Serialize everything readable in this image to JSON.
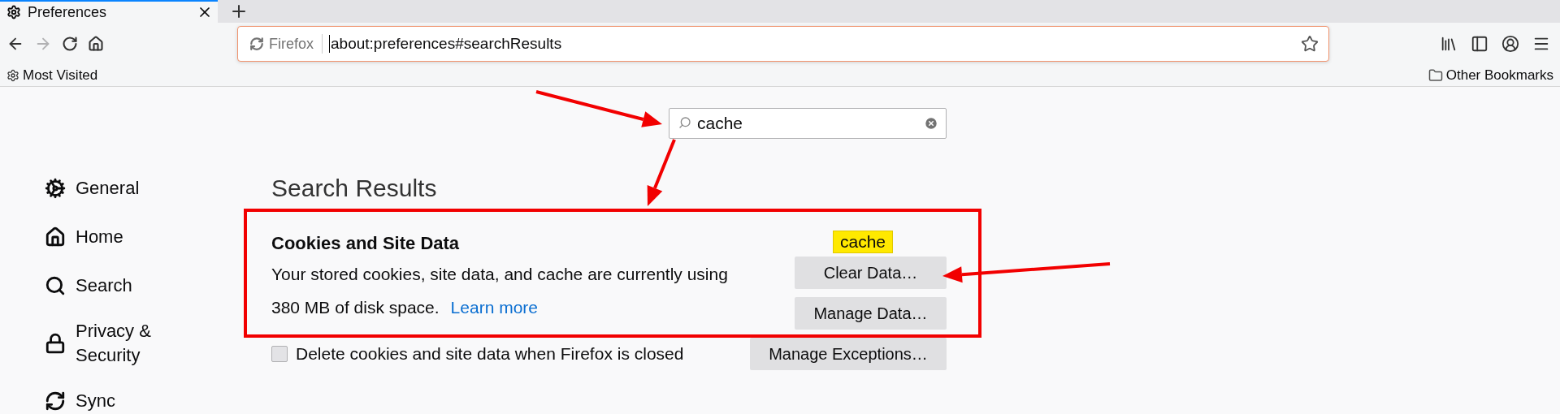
{
  "tabs": [
    {
      "title": "Preferences",
      "selected": true
    }
  ],
  "nav": {
    "back_disabled": false,
    "forward_disabled": true
  },
  "url_bar": {
    "identity": "Firefox",
    "url": "about:preferences#searchResults"
  },
  "bookmarks": [
    {
      "label": "Most Visited",
      "kind": "smart"
    },
    {
      "label": "Other Bookmarks",
      "kind": "folder"
    }
  ],
  "search": {
    "value": "cache"
  },
  "sidebar": {
    "items": [
      {
        "label": "General",
        "kind": "general"
      },
      {
        "label": "Home",
        "kind": "home"
      },
      {
        "label": "Search",
        "kind": "search"
      },
      {
        "label": "Privacy & Security",
        "kind": "privacy"
      },
      {
        "label": "Sync",
        "kind": "sync"
      }
    ]
  },
  "results": {
    "heading": "Search Results",
    "section": {
      "title": "Cookies and Site Data",
      "description": "Your stored cookies, site data, and cache are currently using 380 MB of disk space.",
      "link": "Learn more",
      "buttons": [
        {
          "label": "Clear Data…",
          "tooltip": "cache"
        },
        {
          "label": "Manage Data…"
        }
      ],
      "checkbox": {
        "label": "Delete cookies and site data when Firefox is closed",
        "checked": false
      },
      "exceptions_button": "Manage Exceptions…"
    }
  }
}
